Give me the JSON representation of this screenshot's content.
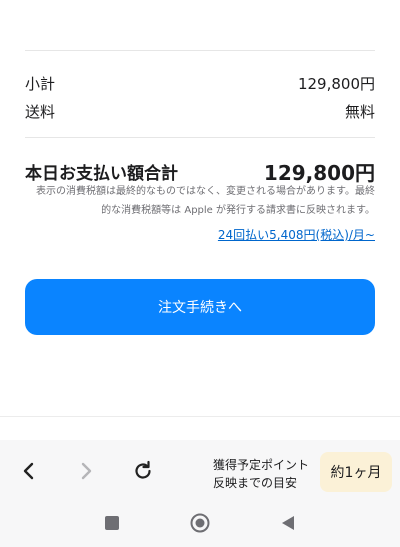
{
  "summary": {
    "subtotal_label": "小計",
    "subtotal_value": "129,800円",
    "shipping_label": "送料",
    "shipping_value": "無料",
    "total_label": "本日お支払い額合計",
    "total_value": "129,800円",
    "tax_note_line1": "表示の消費税額は最終的なものではなく、変更される場合があります。最終",
    "tax_note_line2": "的な消費税額等は Apple が発行する請求書に反映されます。",
    "installment_link": "24回払い5,408円(税込)/月~"
  },
  "checkout": {
    "button_label": "注文手続きへ",
    "button_color": "#0a84ff"
  },
  "browser_bar": {
    "back_icon": "chevron-left-icon",
    "forward_icon": "chevron-right-icon",
    "reload_icon": "reload-icon",
    "points_line1": "獲得予定ポイント",
    "points_line2": "反映までの目安",
    "points_badge": "約1ヶ月",
    "badge_color": "#fbf1d7"
  },
  "system_nav": {
    "recents_icon": "square-icon",
    "home_icon": "home-circle-icon",
    "back_icon": "triangle-back-icon"
  }
}
